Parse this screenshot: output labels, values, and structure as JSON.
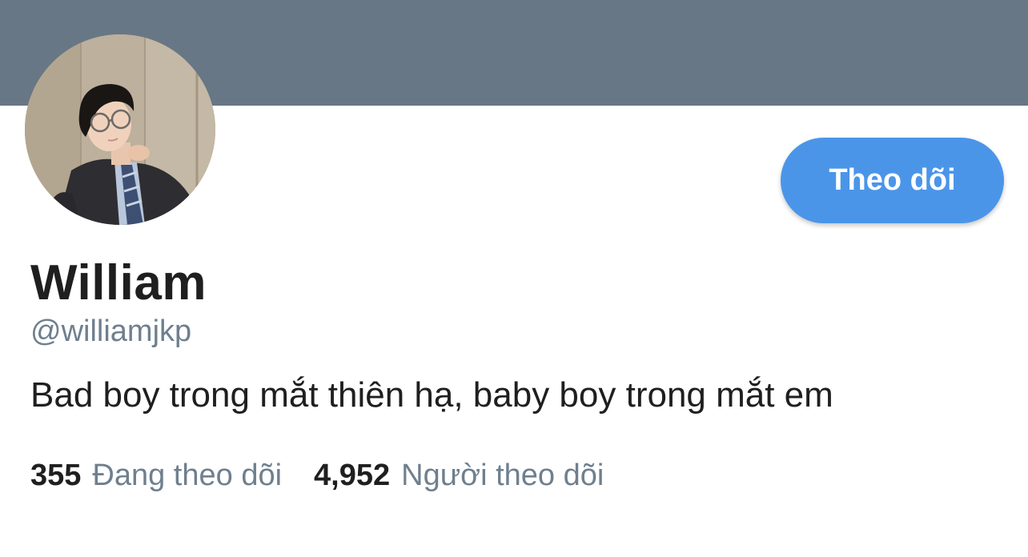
{
  "profile": {
    "display_name": "William",
    "handle": "@williamjkp",
    "bio": "Bad boy trong mắt thiên hạ, baby boy trong mắt em",
    "follow_button_label": "Theo dõi",
    "following_count": "355",
    "following_label": "Đang theo dõi",
    "followers_count": "4,952",
    "followers_label": "Người theo dõi"
  },
  "colors": {
    "banner": "#687785",
    "accent": "#4b95e9",
    "primary_text": "#1f1f1f",
    "secondary_text": "#6f7f8e"
  }
}
